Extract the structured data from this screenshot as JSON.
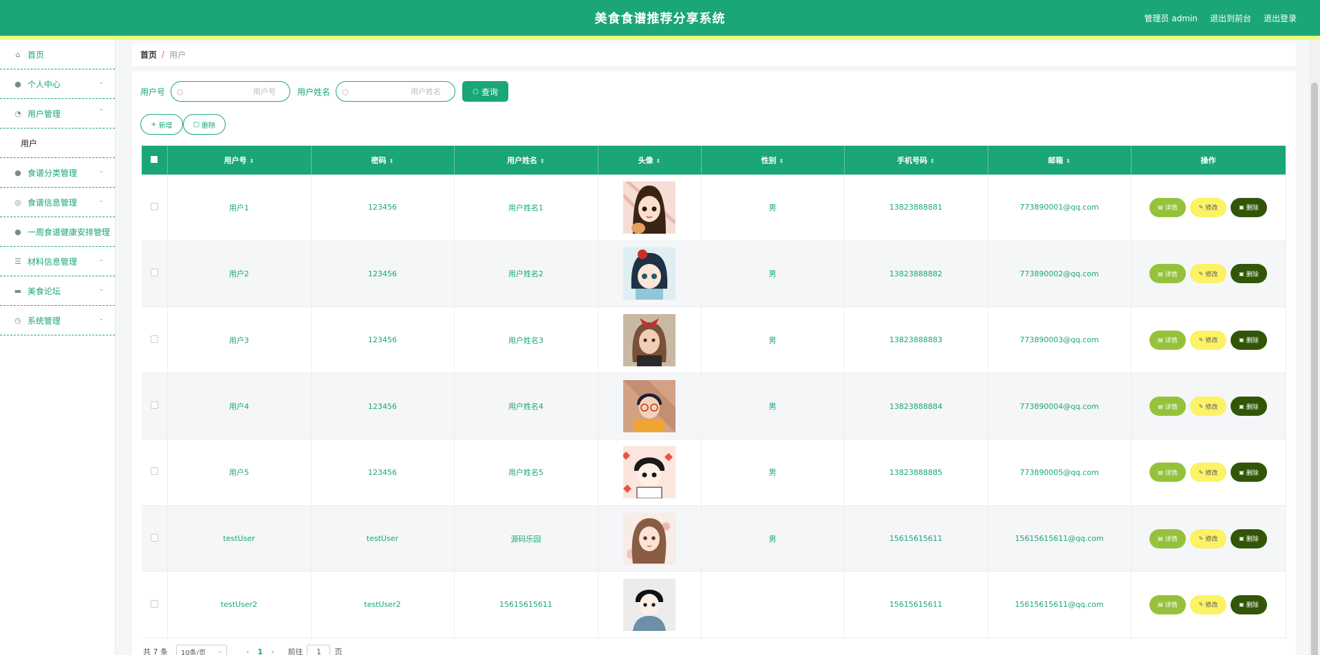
{
  "header": {
    "title": "美食食谱推荐分享系统",
    "admin_label": "管理员 admin",
    "front_link": "退出到前台",
    "logout_link": "退出登录"
  },
  "sidebar": {
    "items": [
      {
        "label": "首页",
        "icon": "home-icon"
      },
      {
        "label": "个人中心",
        "icon": "user-icon"
      },
      {
        "label": "用户管理",
        "icon": "dashboard-icon"
      },
      {
        "label": "食谱分类管理",
        "icon": "user-icon"
      },
      {
        "label": "食谱信息管理",
        "icon": "globe-icon"
      },
      {
        "label": "一周食谱健康安排管理",
        "icon": "location-icon"
      },
      {
        "label": "材料信息管理",
        "icon": "list-icon"
      },
      {
        "label": "美食论坛",
        "icon": "chat-icon"
      },
      {
        "label": "系统管理",
        "icon": "clock-icon"
      }
    ],
    "subitem": "用户"
  },
  "breadcrumb": {
    "home": "首页",
    "separator": "/",
    "current": "用户"
  },
  "search": {
    "field1_label": "用户号",
    "field1_placeholder": "用户号",
    "field2_label": "用户姓名",
    "field2_placeholder": "用户姓名",
    "query_btn": "查询"
  },
  "actions": {
    "add_btn": "新增",
    "delete_btn": "删除"
  },
  "table": {
    "headers": [
      "用户号",
      "密码",
      "用户姓名",
      "头像",
      "性别",
      "手机号码",
      "邮箱",
      "操作"
    ],
    "rows": [
      {
        "id": "用户1",
        "password": "123456",
        "name": "用户姓名1",
        "gender": "男",
        "phone": "13823888881",
        "email": "773890001@qq.com"
      },
      {
        "id": "用户2",
        "password": "123456",
        "name": "用户姓名2",
        "gender": "男",
        "phone": "13823888882",
        "email": "773890002@qq.com"
      },
      {
        "id": "用户3",
        "password": "123456",
        "name": "用户姓名3",
        "gender": "男",
        "phone": "13823888883",
        "email": "773890003@qq.com"
      },
      {
        "id": "用户4",
        "password": "123456",
        "name": "用户姓名4",
        "gender": "男",
        "phone": "13823888884",
        "email": "773890004@qq.com"
      },
      {
        "id": "用户5",
        "password": "123456",
        "name": "用户姓名5",
        "gender": "男",
        "phone": "13823888885",
        "email": "773890005@qq.com"
      },
      {
        "id": "testUser",
        "password": "testUser",
        "name": "源码乐园",
        "gender": "男",
        "phone": "15615615611",
        "email": "15615615611@qq.com"
      },
      {
        "id": "testUser2",
        "password": "testUser2",
        "name": "15615615611",
        "gender": "",
        "phone": "15615615611",
        "email": "15615615611@qq.com"
      }
    ],
    "op_labels": {
      "detail": "详情",
      "edit": "修改",
      "delete": "删除"
    }
  },
  "pagination": {
    "total": "共 7 条",
    "page_size": "10条/页",
    "current_page": "1",
    "goto_prefix": "前往",
    "goto_value": "1",
    "goto_suffix": "页"
  },
  "colors": {
    "primary": "#1aa677",
    "stripe": "#eefc7f",
    "detail_btn": "#96c23b",
    "edit_btn": "#fbf265",
    "delete_btn": "#325607"
  }
}
